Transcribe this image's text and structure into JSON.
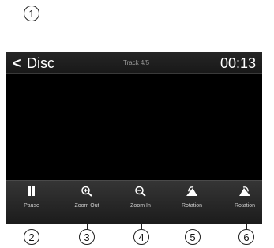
{
  "callouts": {
    "c1": "1",
    "c2": "2",
    "c3": "3",
    "c4": "4",
    "c5": "5",
    "c6": "6"
  },
  "header": {
    "back_glyph": "<",
    "title": "Disc",
    "track": "Track 4/5",
    "time": "00:13"
  },
  "toolbar": {
    "pause_label": "Pause",
    "zoom_out_label": "Zoom Out",
    "zoom_in_label": "Zoom In",
    "rotation_left_label": "Rotation",
    "rotation_right_label": "Rotation"
  },
  "icons": {
    "pause": "pause-icon",
    "zoom_out": "zoom-out-icon",
    "zoom_in": "zoom-in-icon",
    "rotate_left": "rotate-left-icon",
    "rotate_right": "rotate-right-icon"
  },
  "colors": {
    "screen_bg": "#000000",
    "bar_text": "#cfcfcf",
    "title_text": "#ffffff"
  }
}
